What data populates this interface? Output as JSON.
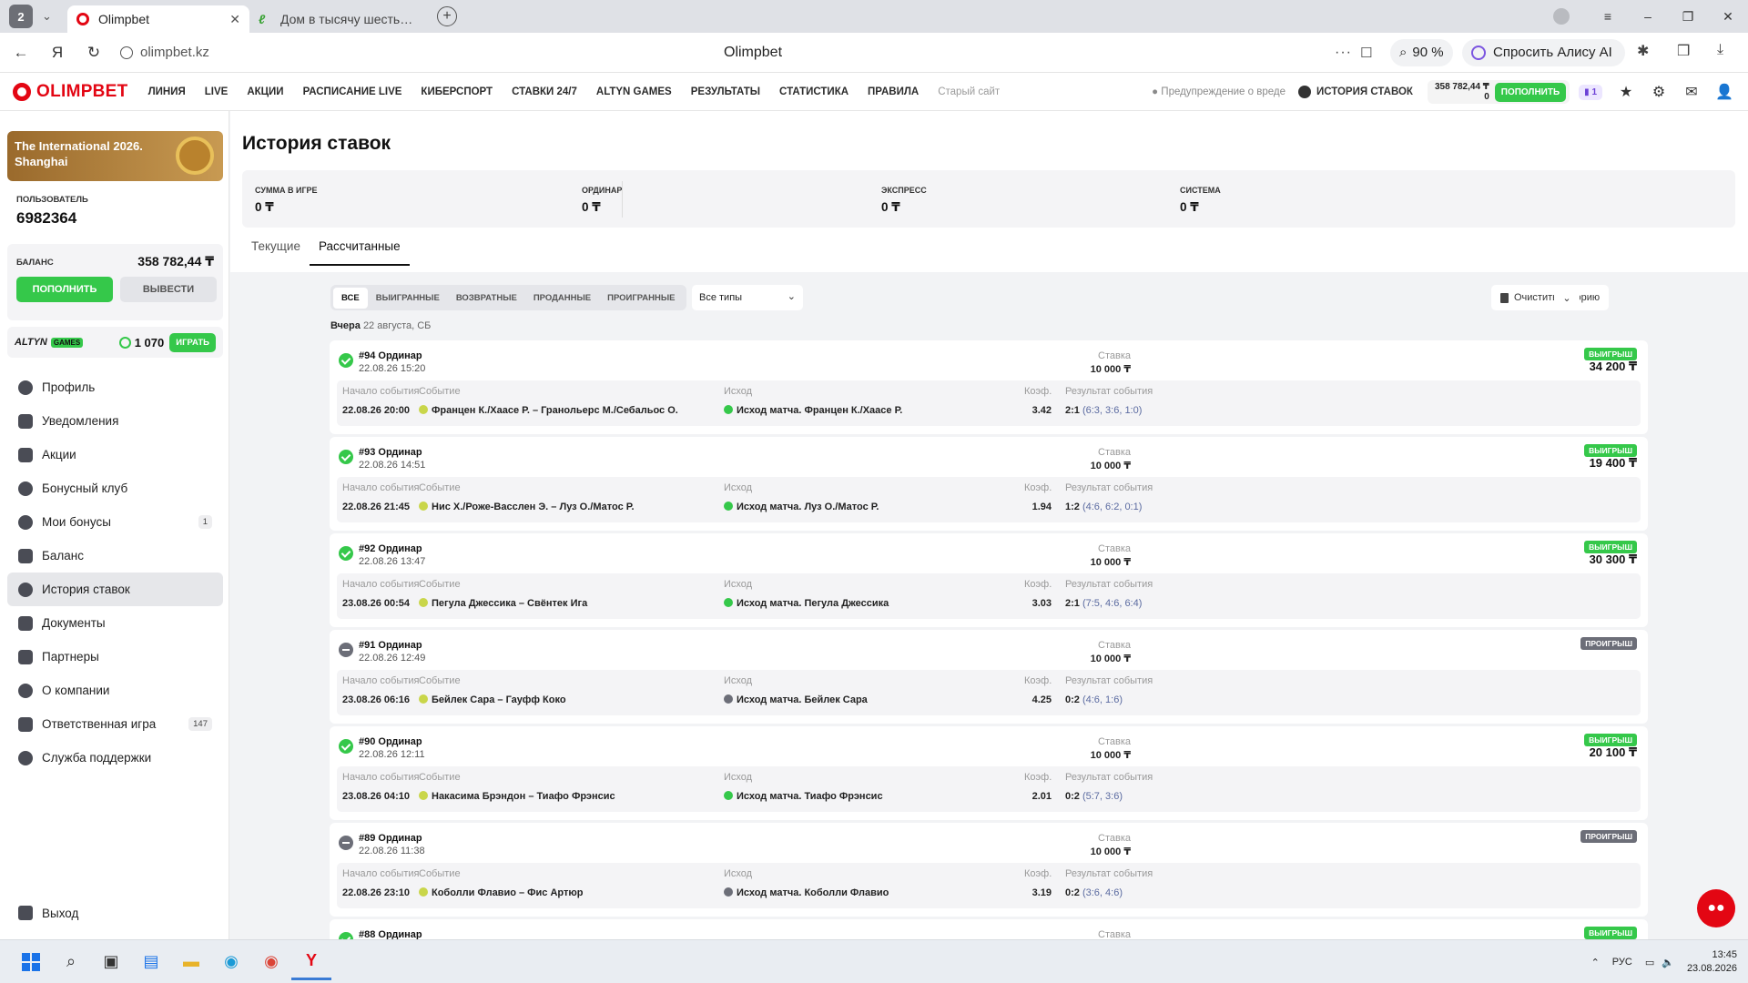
{
  "browser": {
    "tab_count": "2",
    "tabs": [
      {
        "title": "Olimpbet"
      },
      {
        "title": "Дом в тысячу шестьсот э"
      }
    ],
    "url": "olimpbet.kz",
    "page_title": "Olimpbet",
    "zoom": "90 %",
    "alice": "Спросить Алису AI"
  },
  "header": {
    "logo": "OLIMPBET",
    "nav": [
      "ЛИНИЯ",
      "LIVE",
      "АКЦИИ",
      "РАСПИСАНИЕ LIVE",
      "КИБЕРСПОРТ",
      "СТАВКИ 24/7",
      "ALTYN GAMES",
      "РЕЗУЛЬТАТЫ",
      "СТАТИСТИКА",
      "ПРАВИЛА"
    ],
    "old_site": "Старый сайт",
    "warning": "Предупреждение о вреде",
    "history_link": "ИСТОРИЯ СТАВОК",
    "mini_balance": "358 782,44 ₸",
    "mini_bonus": "0",
    "deposit": "ПОПОЛНИТЬ",
    "notif_count": "1"
  },
  "sidebar": {
    "promo": "The International 2026. Shanghai",
    "user_label": "ПОЛЬЗОВАТЕЛЬ",
    "user_id": "6982364",
    "balance_label": "БАЛАНС",
    "balance_value": "358 782,44 ₸",
    "deposit": "ПОПОЛНИТЬ",
    "withdraw": "ВЫВЕСТИ",
    "altyn_logo": "ALTYN",
    "altyn_games": "GAMES",
    "altyn_coins": "1 070",
    "altyn_play": "ИГРАТЬ",
    "items": [
      {
        "label": "Профиль",
        "count": ""
      },
      {
        "label": "Уведомления",
        "count": ""
      },
      {
        "label": "Акции",
        "count": ""
      },
      {
        "label": "Бонусный клуб",
        "count": ""
      },
      {
        "label": "Мои бонусы",
        "count": "1"
      },
      {
        "label": "Баланс",
        "count": ""
      },
      {
        "label": "История ставок",
        "count": ""
      },
      {
        "label": "Документы",
        "count": ""
      },
      {
        "label": "Партнеры",
        "count": ""
      },
      {
        "label": "О компании",
        "count": ""
      },
      {
        "label": "Ответственная игра",
        "count": "147"
      },
      {
        "label": "Служба поддержки",
        "count": ""
      }
    ],
    "logout": "Выход"
  },
  "main": {
    "title": "История ставок",
    "stats": [
      {
        "label": "СУММА В ИГРЕ",
        "value": "0 ₸"
      },
      {
        "label": "ОРДИНАР",
        "value": "0 ₸"
      },
      {
        "label": "ЭКСПРЕСС",
        "value": "0 ₸"
      },
      {
        "label": "СИСТЕМА",
        "value": "0 ₸"
      }
    ],
    "tabs": [
      "Текущие",
      "Рассчитанные"
    ],
    "filters": [
      "ВСЕ",
      "ВЫИГРАННЫЕ",
      "ВОЗВРАТНЫЕ",
      "ПРОДАННЫЕ",
      "ПРОИГРАННЫЕ"
    ],
    "type_select": "Все типы",
    "clear": "Очистить историю",
    "day_label": "Вчера",
    "day_date": "22 августа, СБ",
    "col_headers": {
      "start": "Начало события",
      "event": "Событие",
      "outcome": "Исход",
      "coef": "Коэф.",
      "result": "Результат события",
      "stake": "Ставка"
    },
    "bets": [
      {
        "num": "#94 Ординар",
        "dt": "22.08.26 15:20",
        "stake": "10 000 ₸",
        "status": "ВЫИГРЫШ",
        "win": true,
        "amount": "34 200 ₸",
        "start": "22.08.26 20:00",
        "event": "Францен К./Хаасе Р. – Гранольерс М./Себальос О.",
        "outcome": "Исход матча. Францен К./Хаасе Р.",
        "coef": "3.42",
        "score": "2:1",
        "sets": "(6:3, 3:6, 1:0)"
      },
      {
        "num": "#93 Ординар",
        "dt": "22.08.26 14:51",
        "stake": "10 000 ₸",
        "status": "ВЫИГРЫШ",
        "win": true,
        "amount": "19 400 ₸",
        "start": "22.08.26 21:45",
        "event": "Нис Х./Роже-Васслен Э. – Луз О./Матос Р.",
        "outcome": "Исход матча. Луз О./Матос Р.",
        "coef": "1.94",
        "score": "1:2",
        "sets": "(4:6, 6:2, 0:1)"
      },
      {
        "num": "#92 Ординар",
        "dt": "22.08.26 13:47",
        "stake": "10 000 ₸",
        "status": "ВЫИГРЫШ",
        "win": true,
        "amount": "30 300 ₸",
        "start": "23.08.26 00:54",
        "event": "Пегула Джессика – Свёнтек Ига",
        "outcome": "Исход матча. Пегула Джессика",
        "coef": "3.03",
        "score": "2:1",
        "sets": "(7:5, 4:6, 6:4)"
      },
      {
        "num": "#91 Ординар",
        "dt": "22.08.26 12:49",
        "stake": "10 000 ₸",
        "status": "ПРОИГРЫШ",
        "win": false,
        "amount": "",
        "start": "23.08.26 06:16",
        "event": "Бейлек Сара – Гауфф Коко",
        "outcome": "Исход матча. Бейлек Сара",
        "coef": "4.25",
        "score": "0:2",
        "sets": "(4:6, 1:6)"
      },
      {
        "num": "#90 Ординар",
        "dt": "22.08.26 12:11",
        "stake": "10 000 ₸",
        "status": "ВЫИГРЫШ",
        "win": true,
        "amount": "20 100 ₸",
        "start": "23.08.26 04:10",
        "event": "Накасима Брэндон – Тиафо Фрэнсис",
        "outcome": "Исход матча. Тиафо Фрэнсис",
        "coef": "2.01",
        "score": "0:2",
        "sets": "(5:7, 3:6)"
      },
      {
        "num": "#89 Ординар",
        "dt": "22.08.26 11:38",
        "stake": "10 000 ₸",
        "status": "ПРОИГРЫШ",
        "win": false,
        "amount": "",
        "start": "22.08.26 23:10",
        "event": "Коболли Флавио – Фис Артюр",
        "outcome": "Исход матча. Коболли Флавио",
        "coef": "3.19",
        "score": "0:2",
        "sets": "(3:6, 4:6)"
      },
      {
        "num": "#88 Ординар",
        "dt": "",
        "stake": "",
        "status": "ВЫИГРЫШ",
        "win": true,
        "amount": "",
        "start": "",
        "event": "",
        "outcome": "",
        "coef": "",
        "score": "",
        "sets": ""
      }
    ]
  },
  "taskbar": {
    "lang": "РУС",
    "time": "13:45",
    "date": "23.08.2026"
  },
  "colors": {
    "brand": "#e30613",
    "green": "#35c84a",
    "lose": "#6c6e78"
  }
}
